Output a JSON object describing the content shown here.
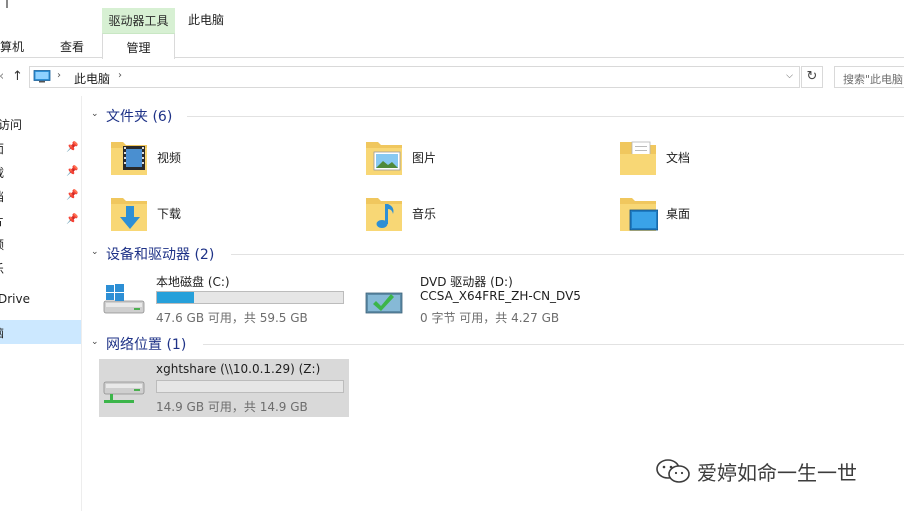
{
  "ribbon": {
    "tool_group": "驱动器工具",
    "context_title": "此电脑",
    "tabs": [
      "计算机",
      "查看"
    ],
    "manage": "管理"
  },
  "address": {
    "crumb": "此电脑",
    "search_placeholder": "搜索\"此电脑\""
  },
  "navpane": {
    "items": [
      "访问",
      "面",
      "载",
      "档",
      "片",
      "频",
      "乐",
      "Drive",
      "脑"
    ]
  },
  "groups": {
    "folders": "文件夹 (6)",
    "devices": "设备和驱动器 (2)",
    "network": "网络位置 (1)"
  },
  "folders": [
    {
      "label": "视频",
      "icon": "videos-folder-icon"
    },
    {
      "label": "图片",
      "icon": "pictures-folder-icon"
    },
    {
      "label": "文档",
      "icon": "documents-folder-icon"
    },
    {
      "label": "下载",
      "icon": "downloads-folder-icon"
    },
    {
      "label": "音乐",
      "icon": "music-folder-icon"
    },
    {
      "label": "桌面",
      "icon": "desktop-folder-icon"
    }
  ],
  "drives": {
    "c": {
      "name": "本地磁盘 (C:)",
      "free": "47.6 GB 可用，共 59.5 GB",
      "used_fraction": 0.2
    },
    "dvd": {
      "name": "DVD 驱动器 (D:)",
      "label": "CCSA_X64FRE_ZH-CN_DV5",
      "free": "0 字节 可用，共 4.27 GB"
    },
    "z": {
      "name": "xghtshare (\\\\10.0.1.29) (Z:)",
      "free": "14.9 GB 可用，共 14.9 GB",
      "used_fraction": 0.0
    }
  },
  "watermark": "爱婷如命一生一世",
  "colors": {
    "accent": "#26a0da",
    "group_title": "#1e3287",
    "tool_group_bg": "#d7f0d3",
    "selection": "#cce8ff"
  }
}
